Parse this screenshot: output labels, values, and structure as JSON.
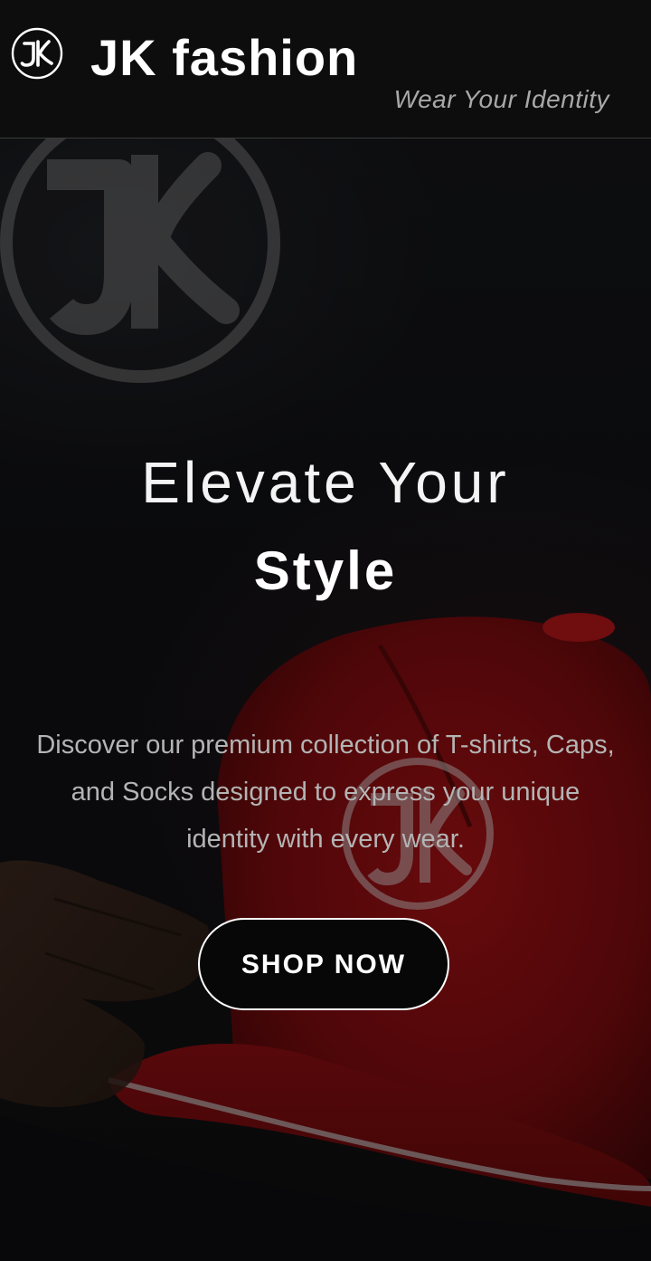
{
  "header": {
    "logo_icon": "jk-monogram-icon",
    "brand_name": "JK fashion",
    "tagline": "Wear Your Identity"
  },
  "hero": {
    "background_image": "red-jk-cap-photo",
    "heading_line1": "Elevate Your",
    "heading_line2": "Style",
    "description": "Discover our premium collection of T-shirts, Caps, and Socks designed to express your unique identity with every wear.",
    "cta_label": "SHOP NOW"
  },
  "colors": {
    "header_background": "#0d0d0d",
    "accent_red": "#8a0d10",
    "text_primary": "#ffffff",
    "text_muted": "#b4b4b4"
  }
}
